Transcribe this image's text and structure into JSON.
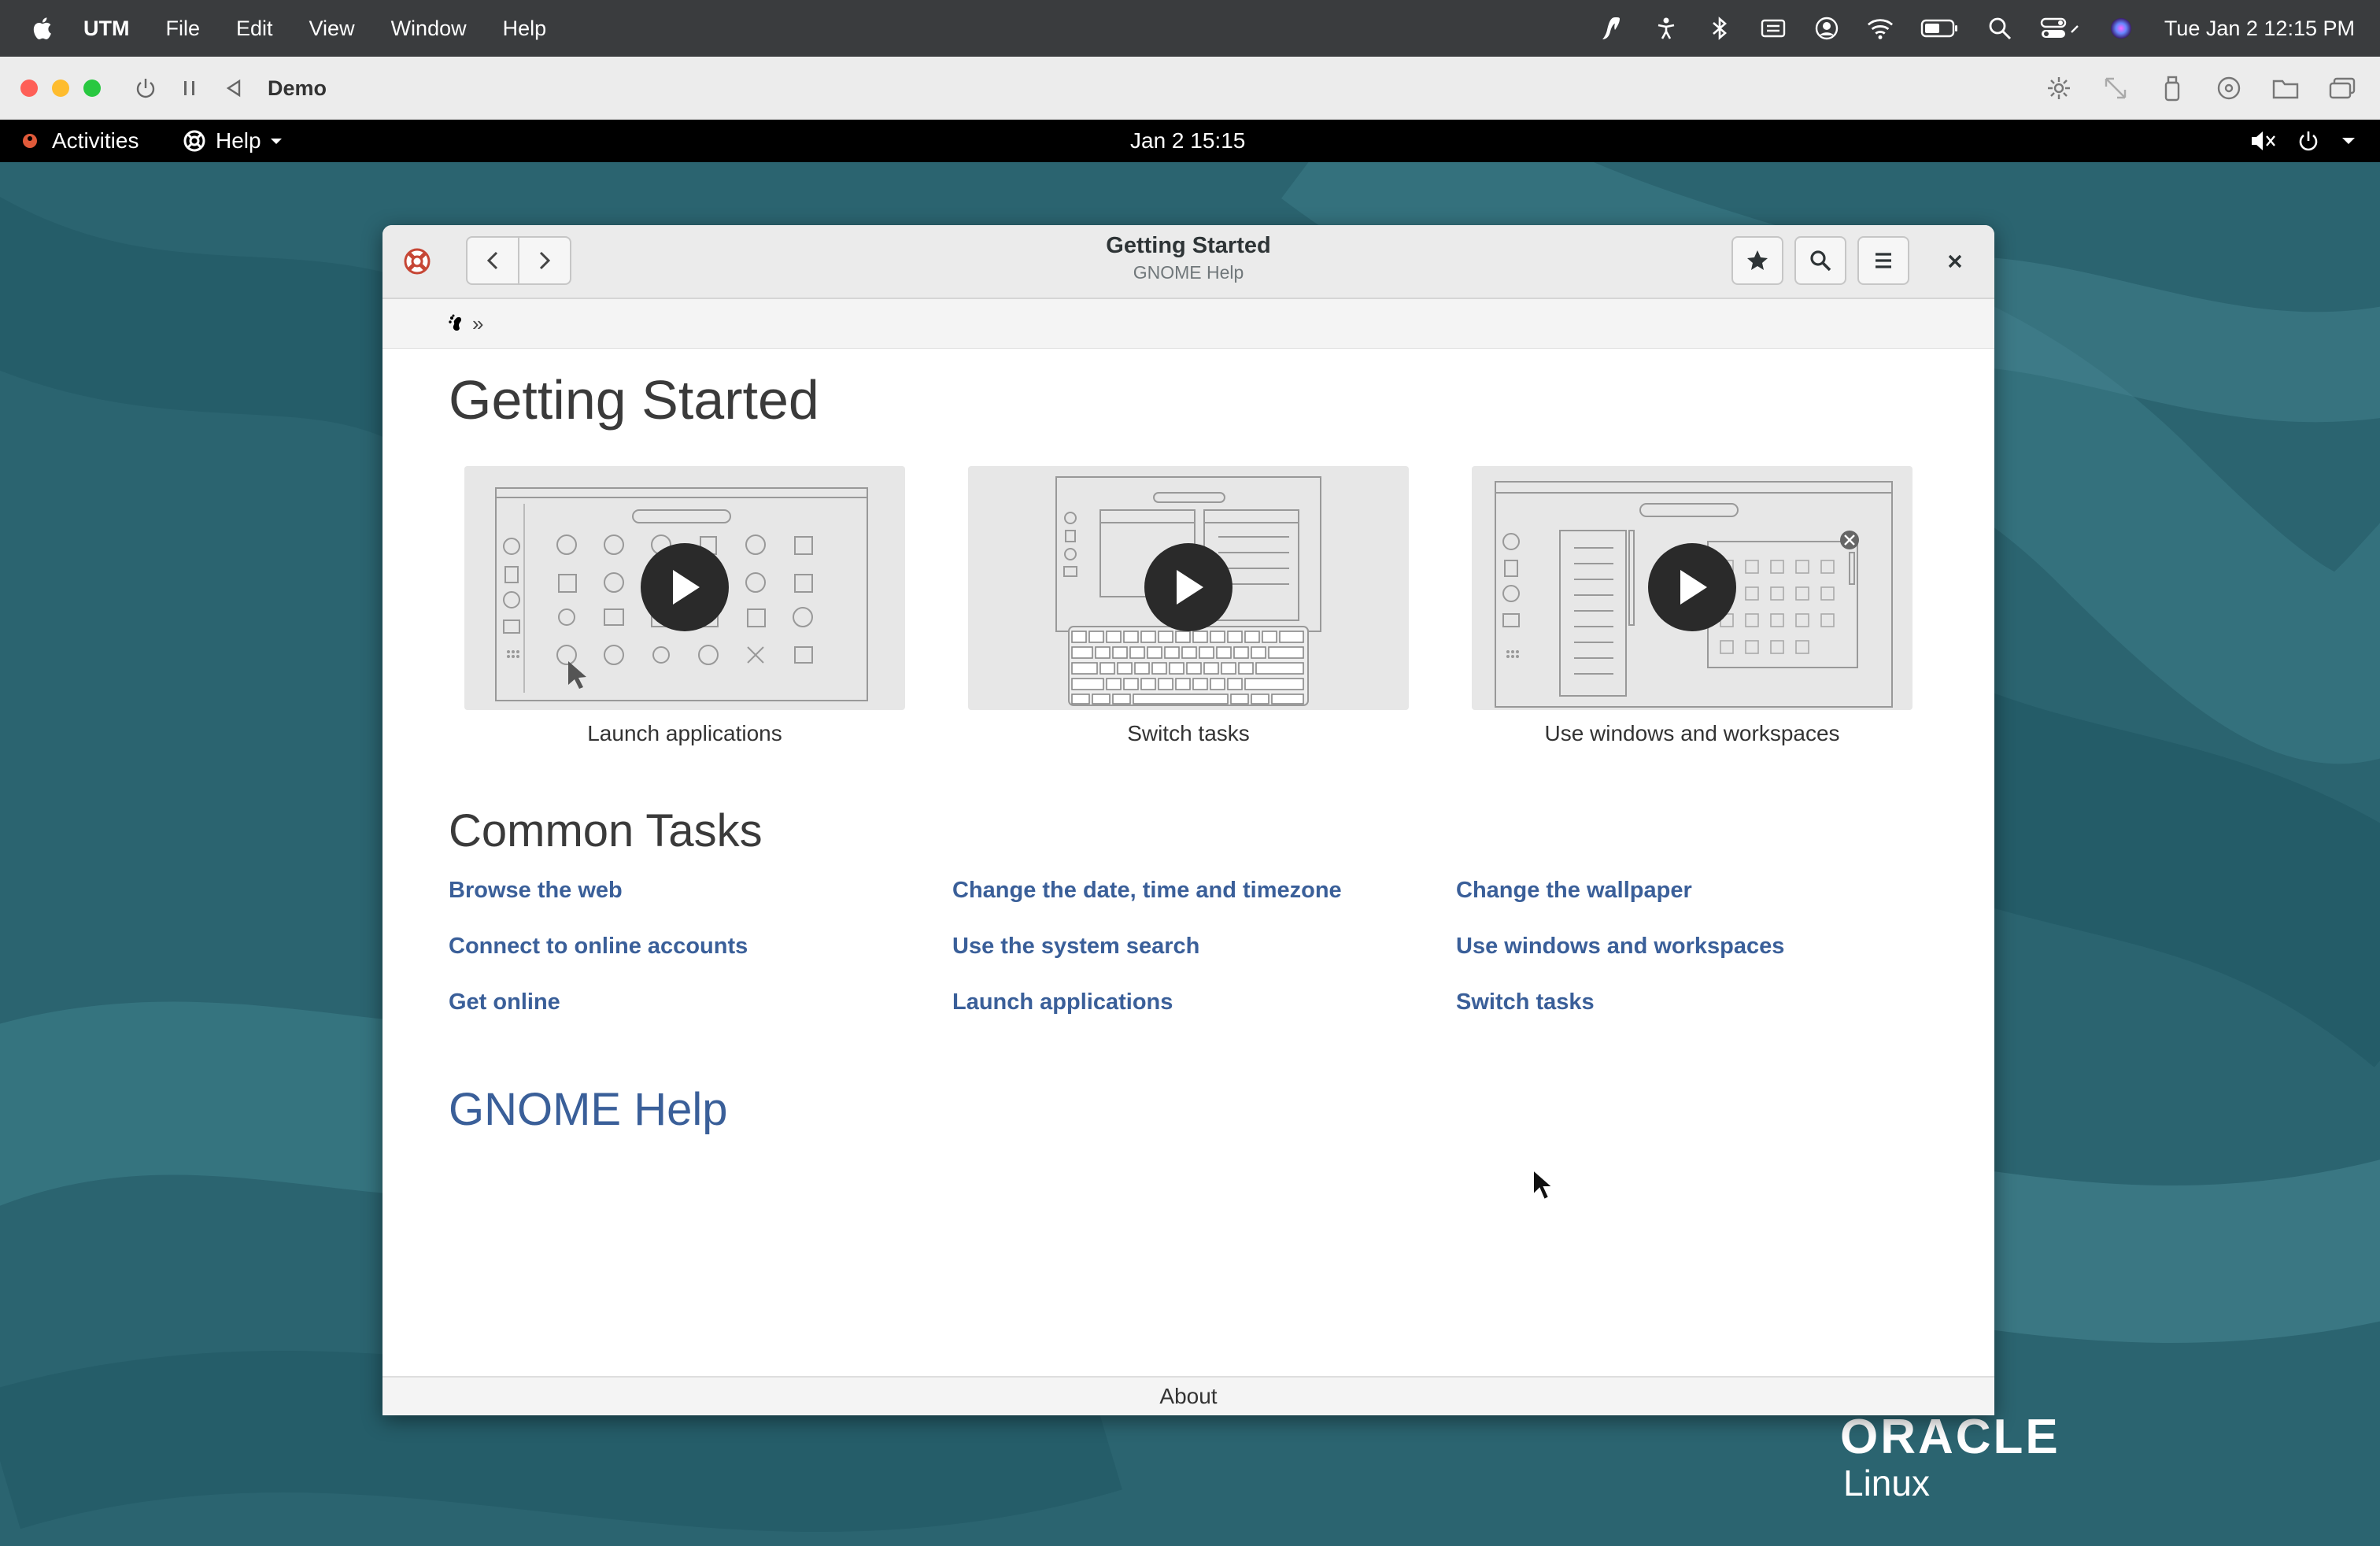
{
  "mac_menubar": {
    "app_name": "UTM",
    "menus": [
      "File",
      "Edit",
      "View",
      "Window",
      "Help"
    ],
    "clock": "Tue Jan 2  12:15 PM",
    "status_icons": [
      "script-icon",
      "accessibility-icon",
      "bluetooth-icon",
      "keyboard-input-icon",
      "user-icon",
      "wifi-icon",
      "battery-icon",
      "spotlight-icon",
      "control-center-icon",
      "siri-icon"
    ]
  },
  "utm_toolbar": {
    "vm_name": "Demo",
    "left_controls": [
      "power-icon",
      "pause-icon",
      "back-icon"
    ],
    "right_controls": [
      "display-icon",
      "resize-icon",
      "usb-icon",
      "drive-icon",
      "folder-icon",
      "windows-icon"
    ]
  },
  "gnome_topbar": {
    "activities": "Activities",
    "app_menu": "Help",
    "datetime": "Jan 2  15:15"
  },
  "help_window": {
    "title": "Getting Started",
    "subtitle": "GNOME Help",
    "breadcrumb_separator": "»",
    "heading": "Getting Started",
    "videos": [
      {
        "label": "Launch applications"
      },
      {
        "label": "Switch tasks"
      },
      {
        "label": "Use windows and workspaces"
      }
    ],
    "common_tasks_heading": "Common Tasks",
    "links": [
      "Browse the web",
      "Change the date, time and timezone",
      "Change the wallpaper",
      "Connect to online accounts",
      "Use the system search",
      "Use windows and workspaces",
      "Get online",
      "Launch applications",
      "Switch tasks"
    ],
    "gnome_help_link": "GNOME Help",
    "footer": "About"
  },
  "desktop": {
    "brand_line1": "ORACLE",
    "brand_line2": "Linux"
  },
  "colors": {
    "link": "#3a5f99",
    "desktop_bg": "#2b6470",
    "mac_close": "#fe5f57",
    "mac_min": "#febc2e",
    "mac_max": "#28c840"
  }
}
